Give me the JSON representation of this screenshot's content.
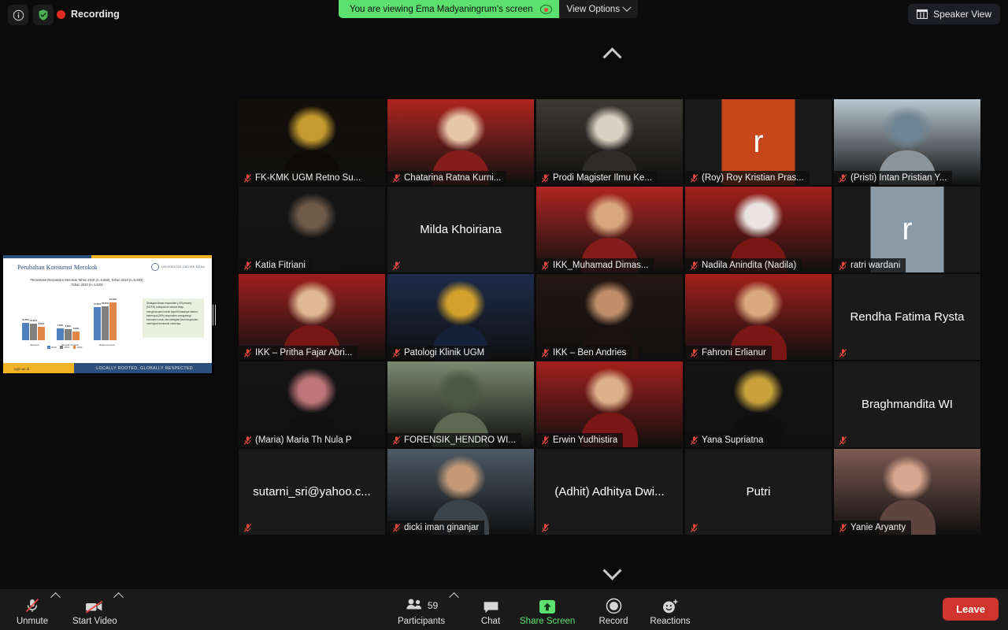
{
  "topbar": {
    "info_icon": "info-icon",
    "shield_icon": "encryption-shield-icon",
    "recording_label": "Recording",
    "share_banner": "You are viewing Ema Madyaningrum's screen",
    "cloud_icon": "screen-share-cloud-icon",
    "view_options_label": "View Options",
    "view_options_caret": "chevron-down-icon",
    "speaker_view_label": "Speaker View",
    "speaker_view_icon": "grid-view-icon"
  },
  "gallery_nav": {
    "up_icon": "chevron-up-icon",
    "down_icon": "chevron-down-icon"
  },
  "shared_screen": {
    "presenter": "Ema Madyaningrum",
    "slide_title": "Perubahan Konsumsi Merokok",
    "slide_subtitle": "Persentase Responden Merokok\nTahun 2018 (n=6.669), Tahun 2019 (n=5.683), Tahun 2020 (n=1.533)",
    "institution": "UNIVERSITAS GADJAH MADA",
    "footer_url": "ugm.ac.id",
    "footer_tagline": "LOCALLY ROOTED, GLOBALLY RESPECTED",
    "callout_text": "Sebagian besar responden (>90 persen) (92,9%) melaporkan bahwa tetap mengkonsumsi rokok seperti biasanya namun, beberapa (26%) responden mengurangi konsumsi rokok dan sebagian kecil responden meningkat konsumsi rokoknya.",
    "divider_handle": "resize-handle"
  },
  "chart_data": {
    "type": "bar",
    "title": "Perubahan Konsumsi Merokok",
    "subtitle": "Persentase Responden Merokok",
    "categories": [
      "Berhenti",
      "Menjadi merokok",
      "Bukan Perokok"
    ],
    "series": [
      {
        "name": "2018",
        "color": "#4e81bd",
        "values": [
          10.5,
          7.5,
          57.0
        ]
      },
      {
        "name": "2019",
        "color": "#808080",
        "values": [
          10.2,
          6.9,
          58.5
        ]
      },
      {
        "name": "2020",
        "color": "#e08646",
        "values": [
          8.2,
          5.3,
          61.7
        ]
      }
    ],
    "data_labels": [
      [
        "10.50%",
        "10.22%",
        "8.20%"
      ],
      [
        "7.50%",
        "6.90%",
        "5.32%"
      ],
      [
        "57.00%",
        "58.50%",
        "61.70%"
      ]
    ],
    "legend_position": "bottom",
    "grid": false,
    "ylabel": "",
    "xlabel": ""
  },
  "tiles": [
    {
      "name": "FK-KMK UGM Retno Su...",
      "muted": true,
      "kind": "photo",
      "bg": "#120e09",
      "accent": "#c59a2e",
      "has_name": true
    },
    {
      "name": "Chatarina Ratna Kurni...",
      "muted": true,
      "kind": "photo",
      "bg": "#b02521",
      "accent": "#e8c7a8",
      "has_name": true
    },
    {
      "name": "Prodi Magister Ilmu Ke...",
      "muted": true,
      "kind": "photo",
      "bg": "#3d3a33",
      "accent": "#d8d2c2",
      "has_name": true
    },
    {
      "name": "(Roy) Roy Kristian Pras...",
      "muted": true,
      "kind": "letter",
      "letter": "r",
      "bg": "#c9451c",
      "has_name": true
    },
    {
      "name": "(Pristi) Intan Pristian Y...",
      "muted": true,
      "kind": "photo",
      "bg": "#b8c6cf",
      "accent": "#6f8494",
      "has_name": true
    },
    {
      "name": "Katia Fitriani",
      "muted": true,
      "kind": "photo",
      "bg": "#171717",
      "accent": "#6d5a49",
      "has_name": true
    },
    {
      "name": "Milda Khoiriana",
      "muted": true,
      "kind": "text",
      "bg": "#1a1a1a",
      "has_name": false
    },
    {
      "name": "IKK_Muhamad Dimas...",
      "muted": true,
      "kind": "photo",
      "bg": "#b02521",
      "accent": "#d8a67e",
      "has_name": true
    },
    {
      "name": "Nadila Anindita (Nadila)",
      "muted": true,
      "kind": "photo",
      "bg": "#a31f1c",
      "accent": "#e9e4e0",
      "has_name": true
    },
    {
      "name": "ratri wardani",
      "muted": true,
      "kind": "letter",
      "letter": "r",
      "bg": "#8a9aa6",
      "has_name": true
    },
    {
      "name": "IKK – Pritha Fajar Abri...",
      "muted": true,
      "kind": "photo",
      "bg": "#9e1f1c",
      "accent": "#e0b894",
      "has_name": true
    },
    {
      "name": "Patologi Klinik UGM",
      "muted": true,
      "kind": "photo",
      "bg": "#1d2b4a",
      "accent": "#d4a22c",
      "has_name": true
    },
    {
      "name": "IKK – Ben Andries",
      "muted": true,
      "kind": "photo",
      "bg": "#241712",
      "accent": "#c08f6a",
      "has_name": true
    },
    {
      "name": "Fahroni Erlianur",
      "muted": true,
      "kind": "photo",
      "bg": "#a31f1c",
      "accent": "#d9a87e",
      "has_name": true
    },
    {
      "name": "Rendha Fatima Rysta",
      "muted": true,
      "kind": "text",
      "bg": "#1a1a1a",
      "has_name": false
    },
    {
      "name": "(Maria) Maria Th Nula P",
      "muted": true,
      "kind": "photo",
      "bg": "#151515",
      "accent": "#c0757a",
      "has_name": true
    },
    {
      "name": "FORENSIK_HENDRO WI...",
      "muted": true,
      "kind": "photo",
      "bg": "#7b8a70",
      "accent": "#4a5a42",
      "has_name": true
    },
    {
      "name": "Erwin Yudhistira",
      "muted": true,
      "kind": "photo",
      "bg": "#a31f1c",
      "accent": "#dcb18a",
      "has_name": true
    },
    {
      "name": "Yana Supriatna",
      "muted": true,
      "kind": "photo",
      "bg": "#141414",
      "accent": "#c8a13a",
      "has_name": true
    },
    {
      "name": "Braghmandita WI",
      "muted": true,
      "kind": "text",
      "bg": "#1a1a1a",
      "has_name": false
    },
    {
      "name": "sutarni_sri@yahoo.c...",
      "muted": true,
      "kind": "text",
      "bg": "#1a1a1a",
      "has_name": false
    },
    {
      "name": "dicki iman ginanjar",
      "muted": true,
      "kind": "photo",
      "bg": "#4d5a66",
      "accent": "#c49a76",
      "has_name": true
    },
    {
      "name": "(Adhit) Adhitya Dwi...",
      "muted": true,
      "kind": "text",
      "bg": "#1a1a1a",
      "has_name": false
    },
    {
      "name": "Putri",
      "muted": true,
      "kind": "text",
      "bg": "#1a1a1a",
      "has_name": false
    },
    {
      "name": "Yanie Aryanty",
      "muted": true,
      "kind": "photo",
      "bg": "#7e5a52",
      "accent": "#d9a78f",
      "has_name": true
    }
  ],
  "toolbar": {
    "unmute_label": "Unmute",
    "unmute_icon": "microphone-muted-icon",
    "unmute_caret": "chevron-up-icon",
    "video_label": "Start Video",
    "video_icon": "camera-off-icon",
    "video_caret": "chevron-up-icon",
    "participants_label": "Participants",
    "participants_icon": "participants-icon",
    "participants_count": "59",
    "participants_caret": "chevron-up-icon",
    "chat_label": "Chat",
    "chat_icon": "chat-bubble-icon",
    "share_label": "Share Screen",
    "share_icon": "share-screen-up-arrow-icon",
    "record_label": "Record",
    "record_icon": "record-circle-icon",
    "reactions_label": "Reactions",
    "reactions_icon": "reactions-smiley-icon",
    "leave_label": "Leave"
  },
  "colors": {
    "accent_green": "#5ce16e",
    "recording_red": "#e02b20",
    "leave_red": "#d0342c",
    "mute_red": "#e8483c"
  }
}
